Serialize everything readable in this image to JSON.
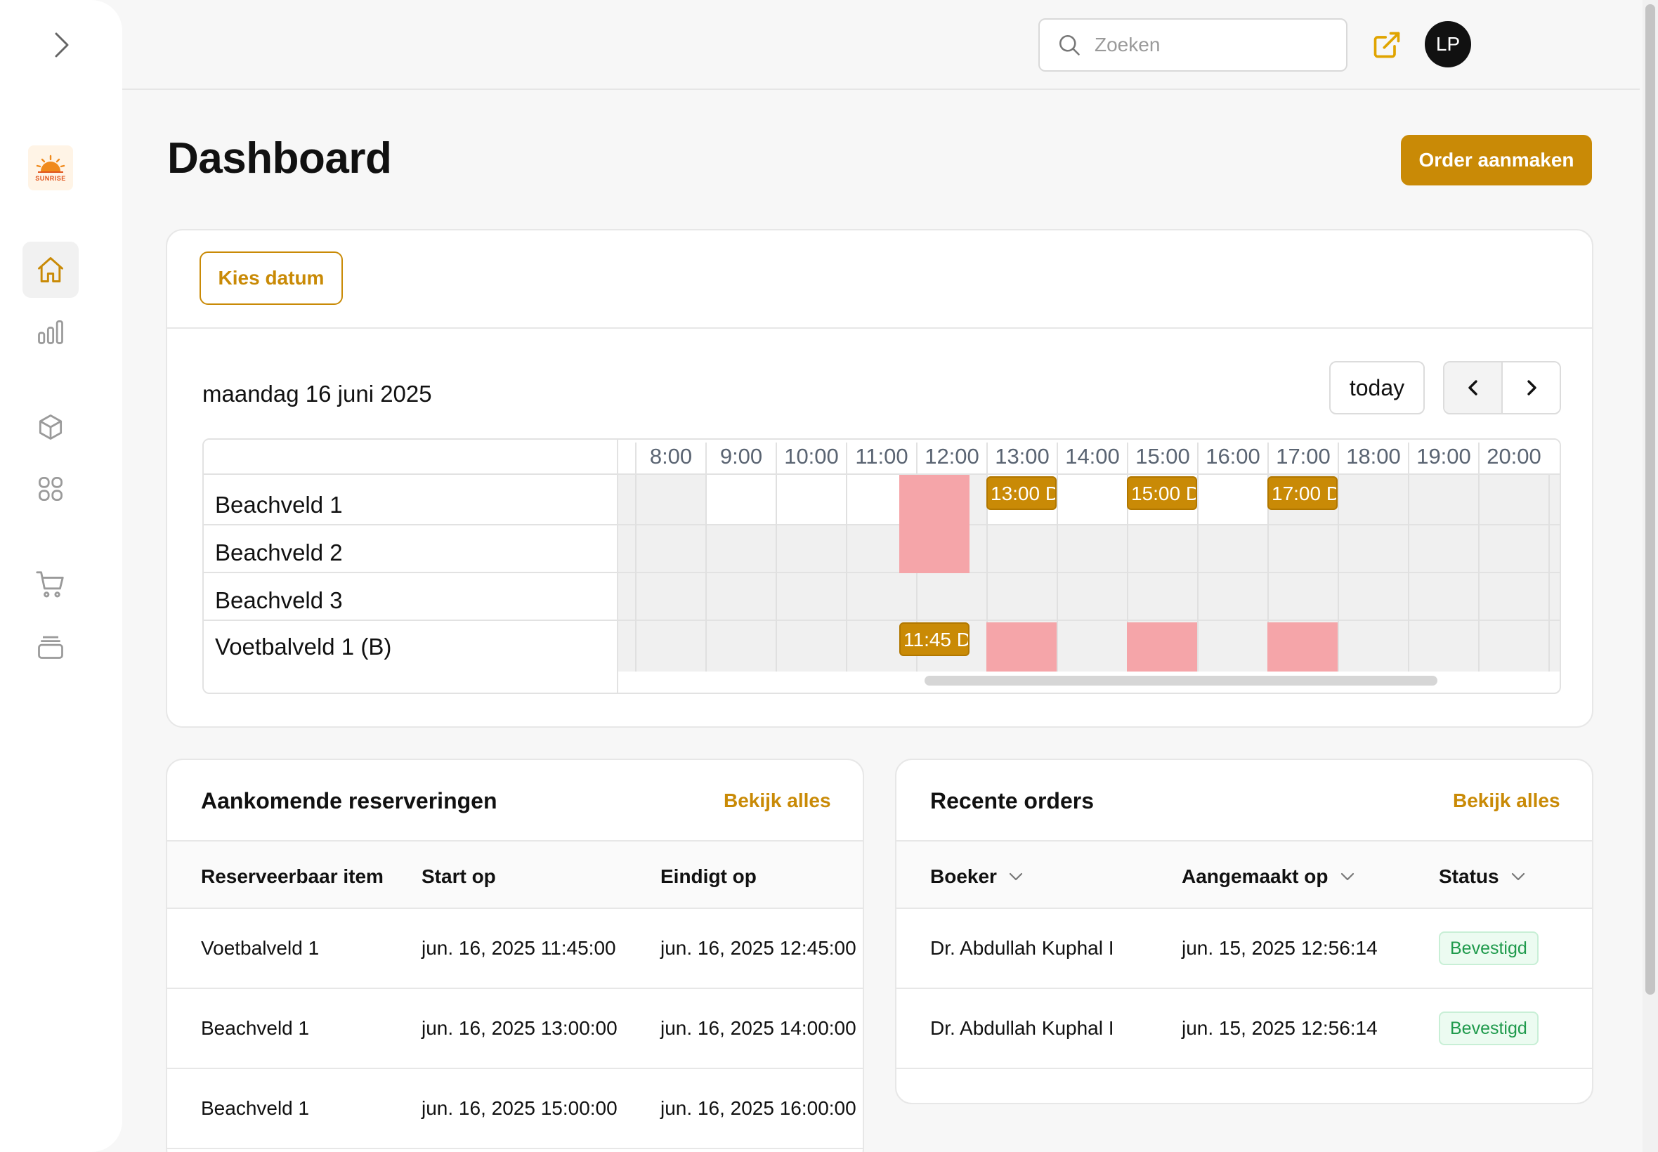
{
  "sidebar": {
    "logo_text": "SUNRISE",
    "items": [
      {
        "name": "home",
        "icon": "home-icon",
        "active": true
      },
      {
        "name": "analytics",
        "icon": "bar-chart-icon"
      },
      {
        "name": "products",
        "icon": "box-icon"
      },
      {
        "name": "apps",
        "icon": "grid-icon"
      },
      {
        "name": "cart",
        "icon": "cart-icon"
      },
      {
        "name": "archive",
        "icon": "stack-icon"
      }
    ]
  },
  "topbar": {
    "search_placeholder": "Zoeken",
    "avatar_initials": "LP"
  },
  "page": {
    "title": "Dashboard",
    "order_button": "Order aanmaken"
  },
  "calendar": {
    "choose_date": "Kies datum",
    "date_title": "maandag 16 juni 2025",
    "today_button": "today",
    "partial_time_label": ")",
    "times": [
      "8:00",
      "9:00",
      "10:00",
      "11:00",
      "12:00",
      "13:00",
      "14:00",
      "15:00",
      "16:00",
      "17:00",
      "18:00",
      "19:00",
      "20:00"
    ],
    "resources": [
      "Beachveld 1",
      "Beachveld 2",
      "Beachveld 3",
      "Voetbalveld 1 (B)"
    ],
    "events": [
      {
        "label": "13:00 D",
        "resource": 0,
        "start": "13:00"
      },
      {
        "label": "15:00 D",
        "resource": 0,
        "start": "15:00"
      },
      {
        "label": "17:00 D",
        "resource": 0,
        "start": "17:00"
      },
      {
        "label": "11:45 D.",
        "resource": 3,
        "start": "11:45"
      }
    ]
  },
  "reservations": {
    "title": "Aankomende reserveringen",
    "see_all": "Bekijk alles",
    "columns": [
      "Reserveerbaar item",
      "Start op",
      "Eindigt op"
    ],
    "rows": [
      [
        "Voetbalveld 1",
        "jun. 16, 2025 11:45:00",
        "jun. 16, 2025 12:45:00"
      ],
      [
        "Beachveld 1",
        "jun. 16, 2025 13:00:00",
        "jun. 16, 2025 14:00:00"
      ],
      [
        "Beachveld 1",
        "jun. 16, 2025 15:00:00",
        "jun. 16, 2025 16:00:00"
      ]
    ]
  },
  "orders": {
    "title": "Recente orders",
    "see_all": "Bekijk alles",
    "columns": [
      "Boeker",
      "Aangemaakt op",
      "Status"
    ],
    "rows": [
      [
        "Dr. Abdullah Kuphal I",
        "jun. 15, 2025 12:56:14",
        "Bevestigd"
      ],
      [
        "Dr. Abdullah Kuphal I",
        "jun. 15, 2025 12:56:14",
        "Bevestigd"
      ]
    ]
  },
  "colors": {
    "accent": "#c98a06",
    "blocked": "#f5a5a9",
    "success": "#1f9a4c"
  }
}
